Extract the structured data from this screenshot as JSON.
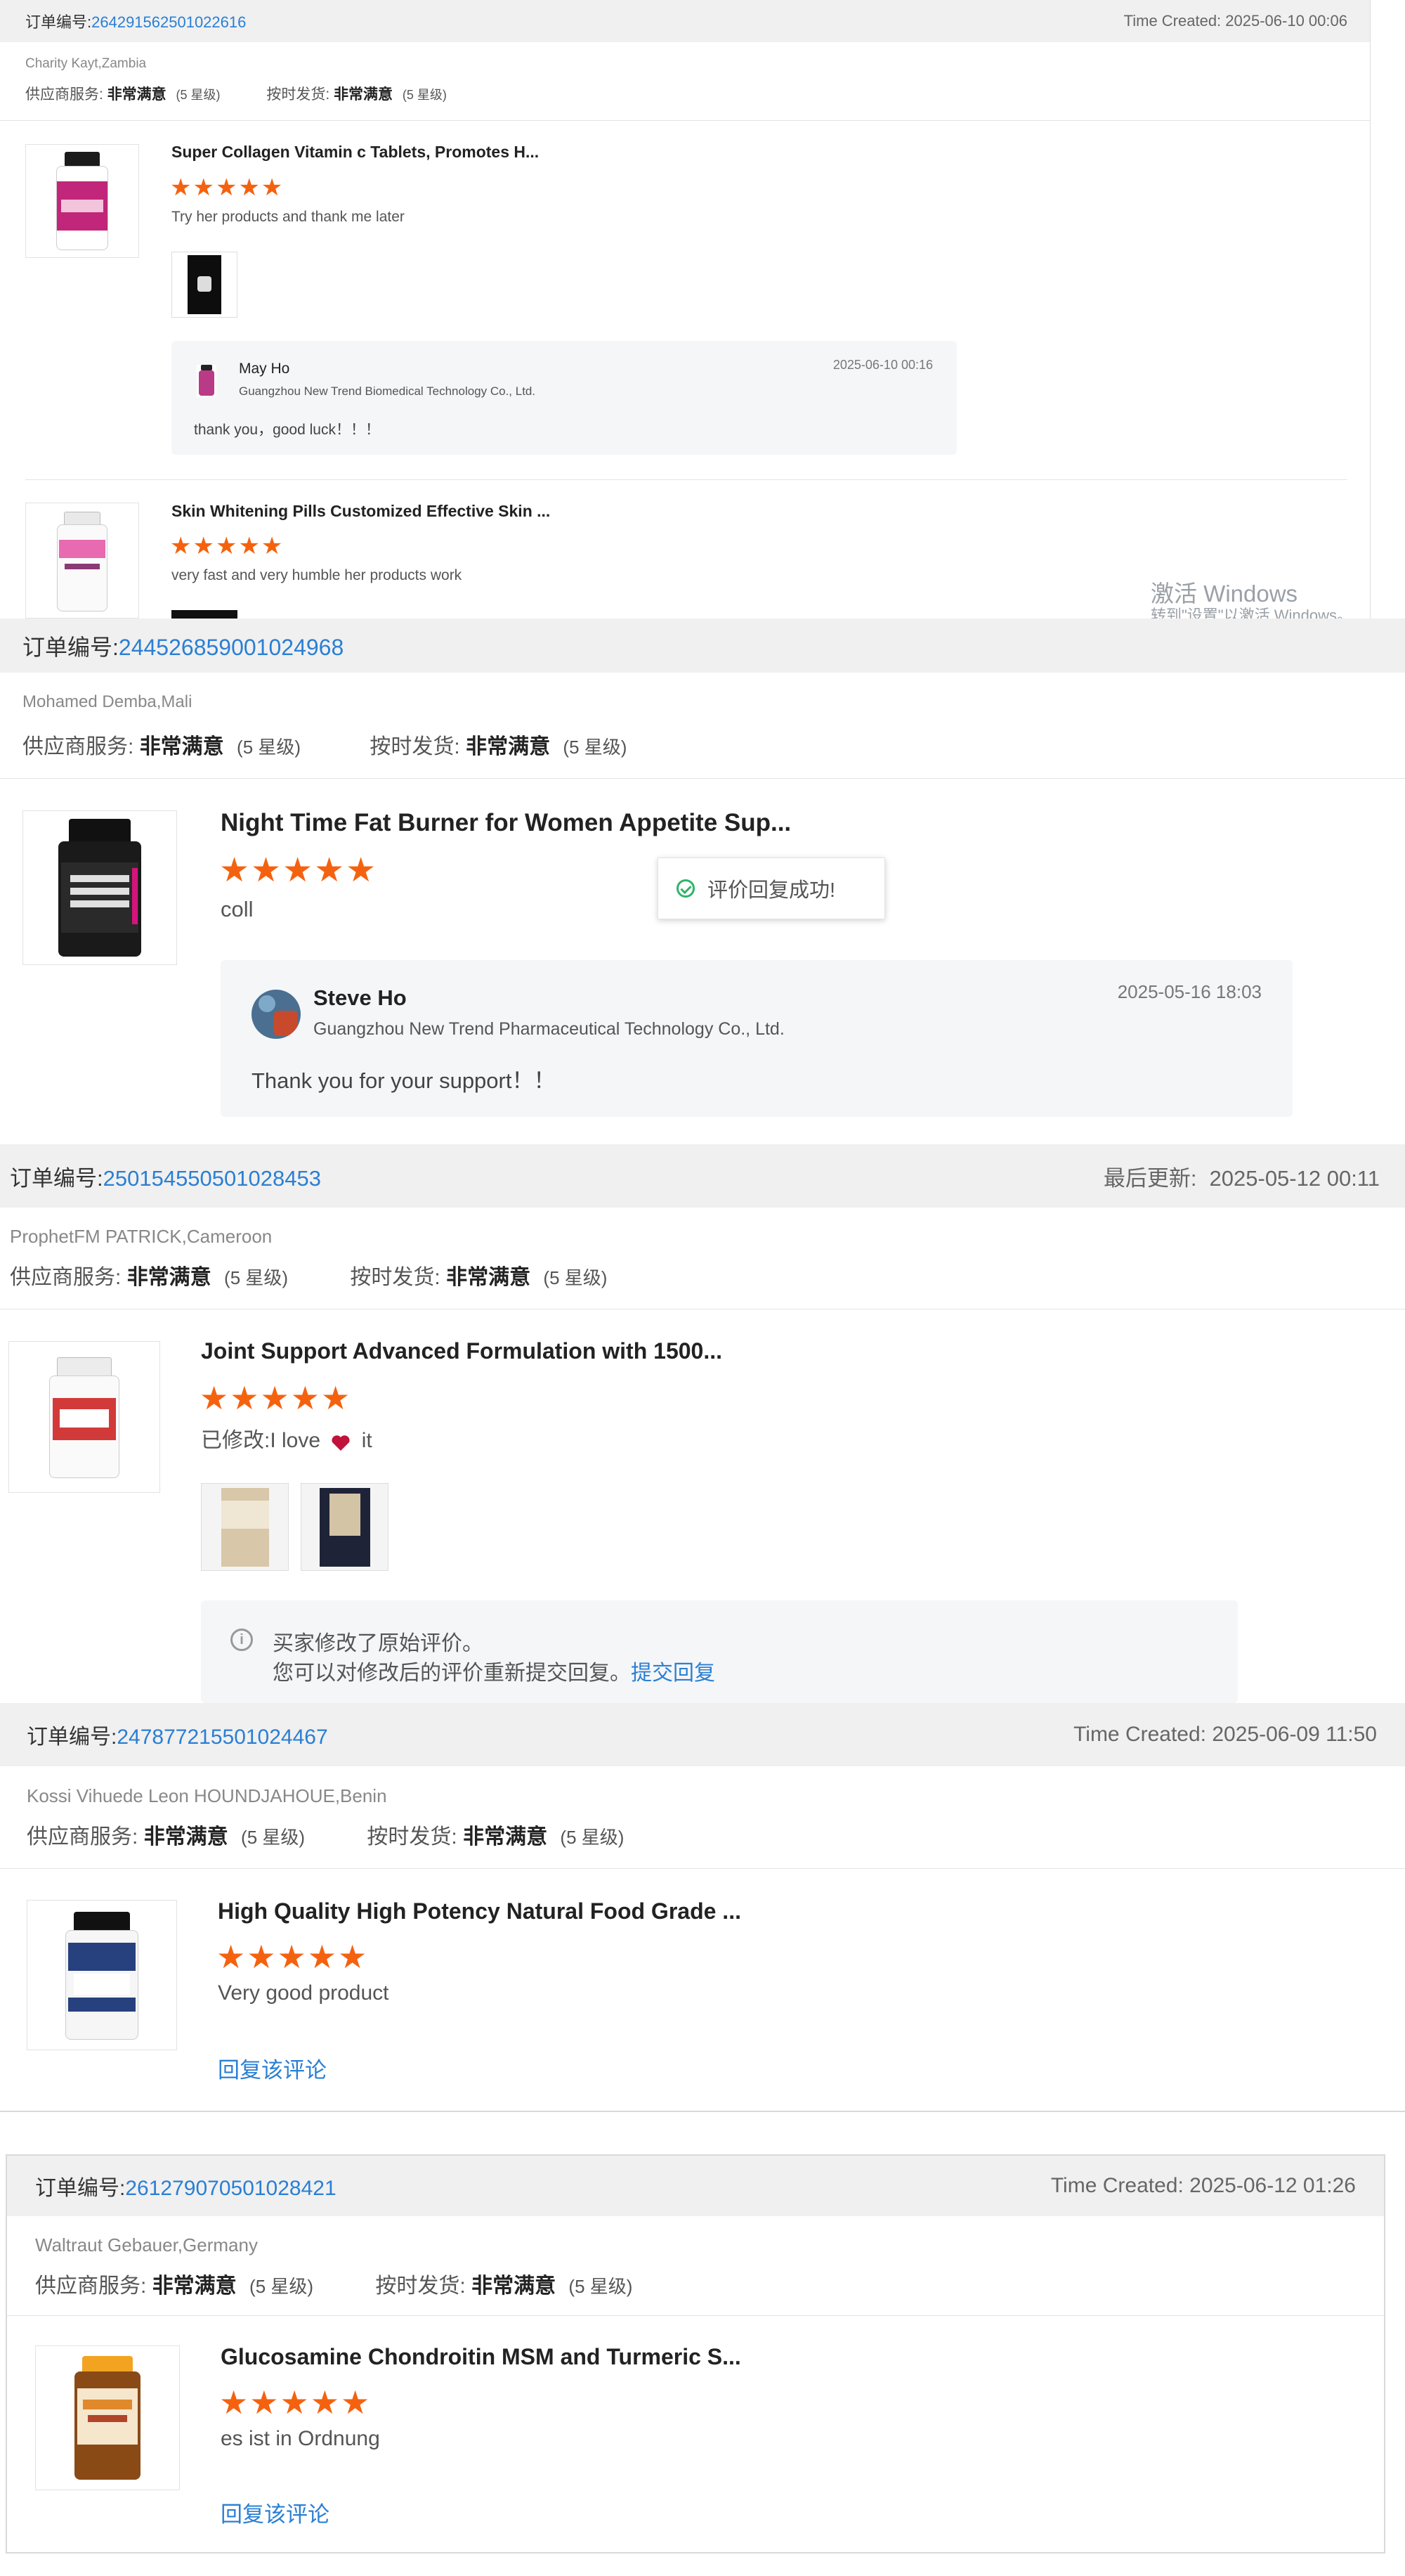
{
  "order_prefix": "订单编号:",
  "service_label": "供应商服务:",
  "shipping_label": "按时发货:",
  "rating_text": "非常满意",
  "rating_level": "(5 星级)",
  "stars": "★★★★★",
  "watermark": {
    "title": "激活 Windows",
    "subtitle": "转到\"设置\"以激活 Windows。"
  },
  "order1": {
    "number": "264291562501022616",
    "created": "Time Created: 2025-06-10 00:06",
    "buyer": "Charity Kayt,Zambia",
    "product1": {
      "title": "Super Collagen Vitamin c Tablets, Promotes H...",
      "comment": "Try her products and thank me later",
      "reply": {
        "name": "May Ho",
        "company": "Guangzhou New Trend Biomedical Technology Co., Ltd.",
        "date": "2025-06-10 00:16",
        "text": "thank you，good luck！！！"
      }
    },
    "product2": {
      "title": "Skin Whitening Pills Customized Effective Skin ...",
      "comment": "very fast and very humble her products work"
    }
  },
  "order2": {
    "number": "244526859001024968",
    "buyer": "Mohamed Demba,Mali",
    "title": "Night Time Fat Burner for Women Appetite Sup...",
    "comment": "coll",
    "toast": "评价回复成功!",
    "reply": {
      "name": "Steve Ho",
      "company": "Guangzhou New Trend Pharmaceutical Technology Co., Ltd.",
      "date": "2025-05-16 18:03",
      "text": "Thank you for your support！！"
    }
  },
  "order3": {
    "number": "250154550501028453",
    "updated_label": "最后更新:",
    "updated": "2025-05-12 00:11",
    "buyer": "ProphetFM PATRICK,Cameroon",
    "title": "Joint Support Advanced Formulation with 1500...",
    "comment_prefix": "已修改:I love",
    "comment_suffix": "it",
    "info_line1": "买家修改了原始评价。",
    "info_line2": "您可以对修改后的评价重新提交回复。",
    "info_link": "提交回复"
  },
  "order4": {
    "number": "247877215501024467",
    "created": "Time Created: 2025-06-09 11:50",
    "buyer": "Kossi Vihuede Leon HOUNDJAHOUE,Benin",
    "title": "High Quality High Potency Natural Food Grade ...",
    "comment": "Very good product",
    "reply_link": "回复该评论"
  },
  "order5": {
    "number": "261279070501028421",
    "created": "Time Created: 2025-06-12 01:26",
    "buyer": "Waltraut Gebauer,Germany",
    "title": "Glucosamine Chondroitin MSM and Turmeric S...",
    "comment": "es ist in Ordnung",
    "reply_link": "回复该评论"
  }
}
